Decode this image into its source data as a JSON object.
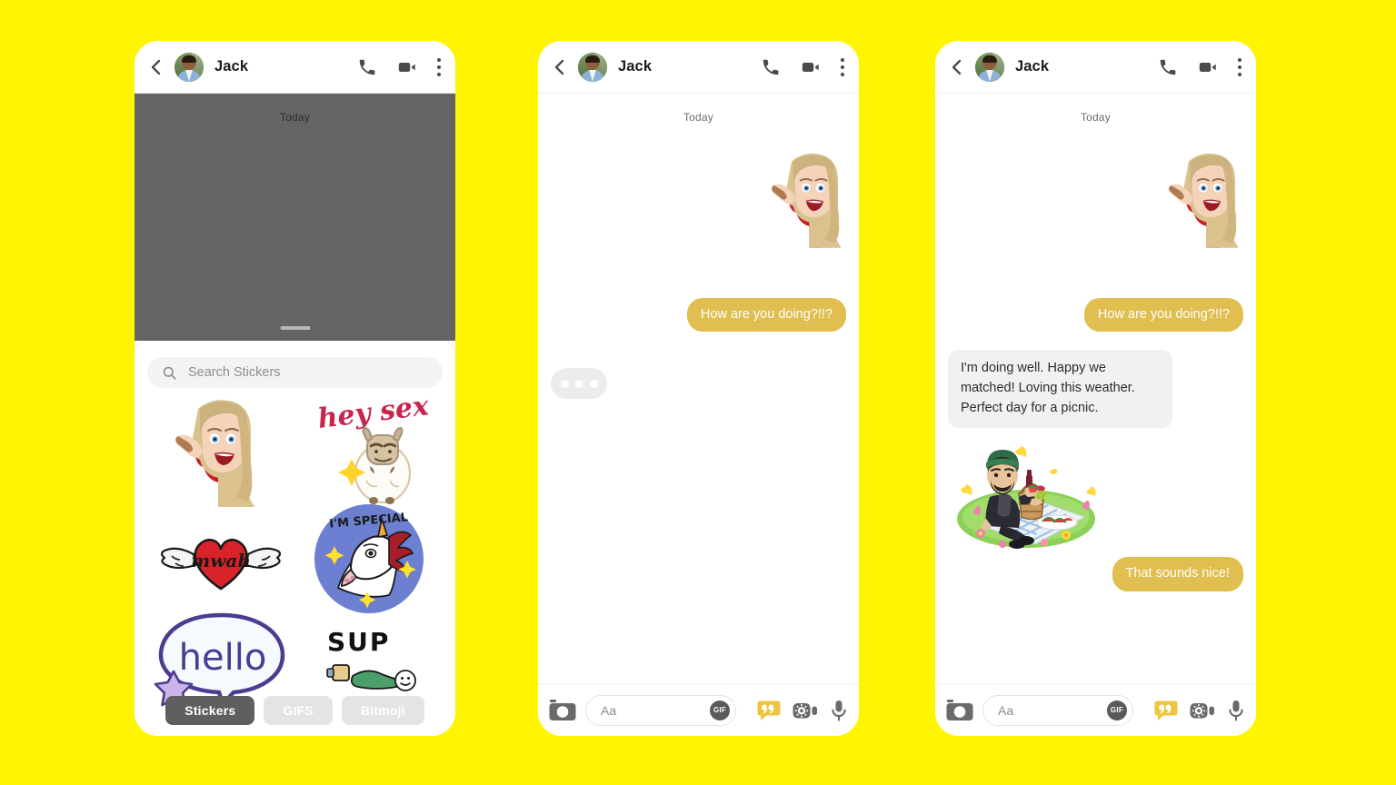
{
  "background_color": "#FFF500",
  "accent_color": "#E0BE4F",
  "overlay_color": "#656565",
  "phones": [
    {
      "id": "phone-1",
      "header": {
        "contact_name": "Jack",
        "back_icon": "chevron-left-icon",
        "avatar": "contact-avatar",
        "call_icon": "phone-call-icon",
        "video_icon": "video-camera-icon",
        "menu_icon": "more-vertical-icon"
      },
      "day_divider": "Today",
      "sticker_tray": {
        "search_placeholder": "Search Stickers",
        "search_icon": "search-icon",
        "grabber": "drag-handle",
        "stickers": [
          {
            "name": "bitmoji-wave-sticker",
            "label": ""
          },
          {
            "name": "hey-sexy-llama-sticker",
            "label": "hey sexy"
          },
          {
            "name": "mwah-winged-heart-sticker",
            "label": "mwah"
          },
          {
            "name": "im-special-unicorn-sticker",
            "label": "I'M SPECIAL"
          },
          {
            "name": "hello-speech-bubble-sticker",
            "label": "hello"
          },
          {
            "name": "sup-sticker",
            "label": "SUP"
          }
        ],
        "tabs": [
          {
            "label": "Stickers",
            "active": true
          },
          {
            "label": "GIFS",
            "active": false
          },
          {
            "label": "Bitmoji",
            "active": false
          }
        ]
      }
    },
    {
      "id": "phone-2",
      "header": {
        "contact_name": "Jack"
      },
      "day_divider": "Today",
      "messages": [
        {
          "type": "sticker",
          "name": "bitmoji-wave-sticker",
          "direction": "out"
        },
        {
          "type": "text",
          "text": "How are you doing?!!?",
          "direction": "out"
        },
        {
          "type": "typing",
          "direction": "in"
        }
      ],
      "input_bar": {
        "camera_icon": "camera-icon",
        "placeholder": "Aa",
        "gif_label": "GIF",
        "sticker_icon": "sticker-quote-icon",
        "video_icon": "video-effects-icon",
        "mic_icon": "microphone-icon"
      }
    },
    {
      "id": "phone-3",
      "header": {
        "contact_name": "Jack"
      },
      "day_divider": "Today",
      "messages": [
        {
          "type": "sticker",
          "name": "bitmoji-wave-sticker",
          "direction": "out"
        },
        {
          "type": "text",
          "text": "How are you doing?!!?",
          "direction": "out"
        },
        {
          "type": "text",
          "text": "I'm doing well. Happy we matched! Loving this weather. Perfect day for a picnic.",
          "direction": "in"
        },
        {
          "type": "sticker",
          "name": "bitmoji-picnic-sticker",
          "direction": "in"
        },
        {
          "type": "text",
          "text": "That sounds nice!",
          "direction": "out"
        }
      ],
      "input_bar": {
        "camera_icon": "camera-icon",
        "placeholder": "Aa",
        "gif_label": "GIF",
        "sticker_icon": "sticker-quote-icon",
        "video_icon": "video-effects-icon",
        "mic_icon": "microphone-icon"
      }
    }
  ]
}
